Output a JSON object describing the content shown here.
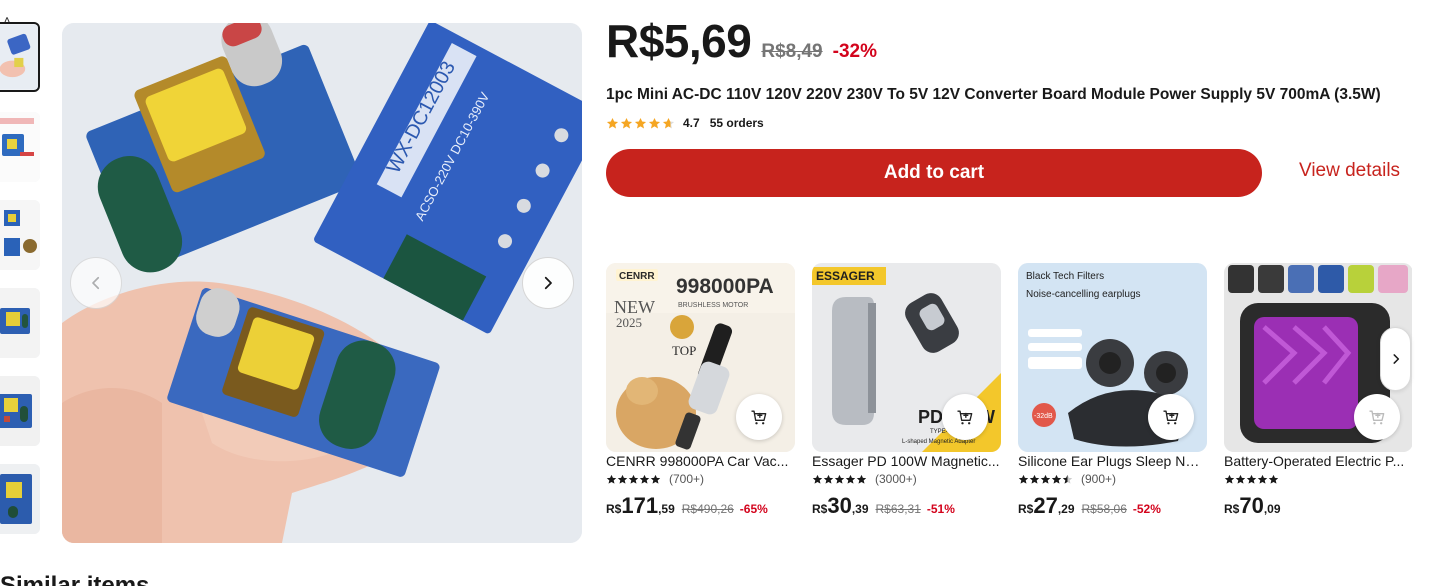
{
  "gallery": {
    "up_arrow_icon": "chevron-up-icon",
    "thumbnails": [
      {
        "name": "thumbnail-1",
        "active": true
      },
      {
        "name": "thumbnail-2",
        "active": false
      },
      {
        "name": "thumbnail-3",
        "active": false
      },
      {
        "name": "thumbnail-4",
        "active": false
      },
      {
        "name": "thumbnail-5",
        "active": false
      },
      {
        "name": "thumbnail-6",
        "active": false
      }
    ],
    "prev_icon": "chevron-left-icon",
    "next_icon": "chevron-right-icon"
  },
  "product": {
    "price": "R$5,69",
    "original_price": "R$8,49",
    "discount": "-32%",
    "title": "1pc Mini AC-DC 110V 120V 220V 230V To 5V 12V Converter Board Module Power Supply 5V 700mA (3.5W)",
    "rating": 4.7,
    "rating_text": "4.7",
    "orders": "55 orders",
    "star_color": "#f5a623",
    "add_to_cart_label": "Add to cart",
    "view_details_label": "View details",
    "accent_color": "#c7231d"
  },
  "recommendations": {
    "items": [
      {
        "name": "CENRR 998000PA Car Vac...",
        "reviews": "(700+)",
        "rating": 5,
        "currency": "R$",
        "price_int": "171",
        "price_dec": ",59",
        "old_price": "R$490,26",
        "discount": "-65%",
        "image_texts": [
          "CENRR",
          "998000PA",
          "BRUSHLESS MOTOR",
          "NEW",
          "2025",
          "TOP"
        ]
      },
      {
        "name": "Essager PD 100W Magnetic...",
        "reviews": "(3000+)",
        "rating": 5,
        "currency": "R$",
        "price_int": "30",
        "price_dec": ",39",
        "old_price": "R$63,31",
        "discount": "-51%",
        "image_texts": [
          "ESSAGER",
          "PD 100W",
          "TYPE-C",
          "L-shaped Magnetic Adapter"
        ]
      },
      {
        "name": "Silicone Ear Plugs Sleep Noi...",
        "reviews": "(900+)",
        "rating": 4.5,
        "currency": "R$",
        "price_int": "27",
        "price_dec": ",29",
        "old_price": "R$58,06",
        "discount": "-52%",
        "image_texts": [
          "Black Tech Filters",
          "Noise-cancelling earplugs",
          "-32dB"
        ]
      },
      {
        "name": "Battery-Operated Electric P...",
        "reviews": "",
        "rating": 5,
        "currency": "R$",
        "price_int": "70",
        "price_dec": ",09",
        "old_price": "",
        "discount": "",
        "image_texts": []
      }
    ],
    "next_icon": "chevron-right-icon",
    "cart_icon": "add-to-cart-icon"
  },
  "section": {
    "similar_heading": "Similar items"
  }
}
